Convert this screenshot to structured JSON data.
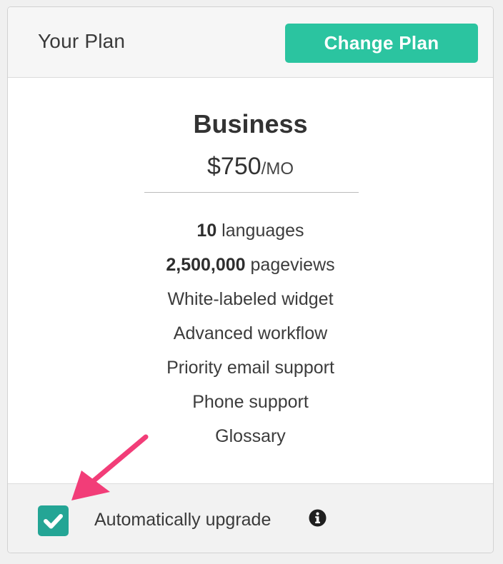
{
  "header": {
    "title": "Your Plan",
    "change_plan_label": "Change Plan"
  },
  "plan": {
    "name": "Business",
    "price": "$750",
    "price_unit": "/MO",
    "features": [
      {
        "bold": "10",
        "text": " languages"
      },
      {
        "bold": "2,500,000",
        "text": " pageviews"
      },
      {
        "bold": "",
        "text": "White-labeled widget"
      },
      {
        "bold": "",
        "text": "Advanced workflow"
      },
      {
        "bold": "",
        "text": "Priority email support"
      },
      {
        "bold": "",
        "text": "Phone support"
      },
      {
        "bold": "",
        "text": "Glossary"
      }
    ]
  },
  "footer": {
    "auto_upgrade_label": "Automatically upgrade",
    "auto_upgrade_checked": true
  },
  "icons": {
    "info": "info-circle-icon",
    "checkbox_check": "checkmark-icon",
    "annotation_arrow": "arrow-icon"
  },
  "colors": {
    "accent": "#2bc4a0",
    "checkbox": "#24a595",
    "annotation": "#f23d78"
  }
}
